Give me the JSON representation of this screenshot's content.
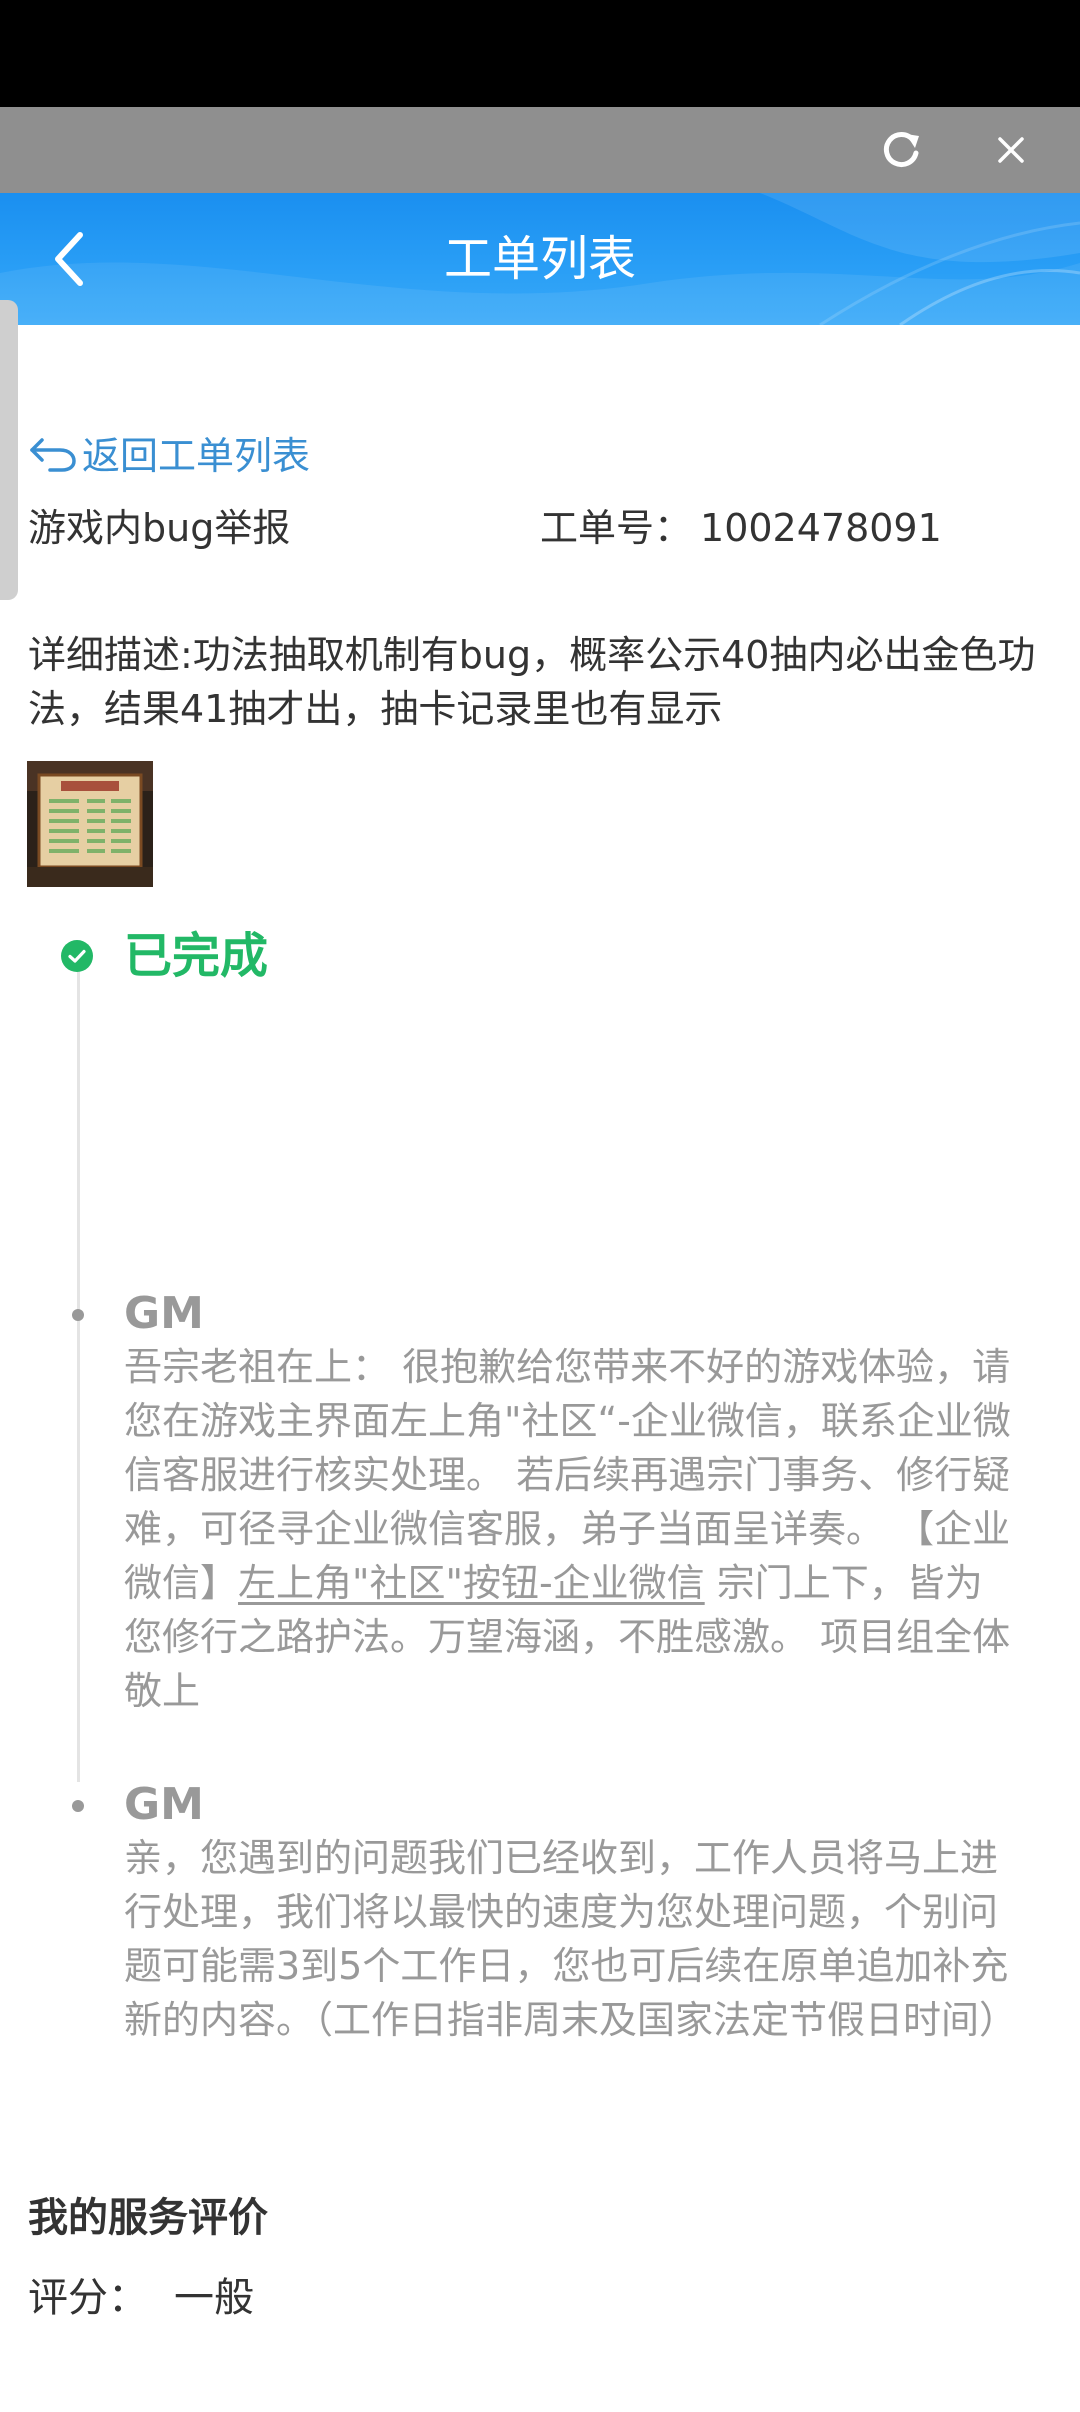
{
  "browser": {
    "refresh_icon": "refresh-icon",
    "close_icon": "close-icon"
  },
  "header": {
    "title": "工单列表",
    "back_icon": "chevron-left-icon",
    "background": "#2a9ff6"
  },
  "ticket": {
    "return_link": "返回工单列表",
    "type": "游戏内bug举报",
    "number_label": "工单号：",
    "number": "1002478091",
    "description": "详细描述:功法抽取机制有bug，概率公示40抽内必出金色功法，结果41抽才出，抽卡记录里也有显示"
  },
  "status": {
    "label": "已完成",
    "color": "#22b866"
  },
  "messages": [
    {
      "author": "GM",
      "body_before": "吾宗老祖在上： 很抱歉给您带来不好的游戏体验，请您在游戏主界面左上角\"社区“-企业微信，联系企业微信客服进行核实处理。 若后续再遇宗门事务、修行疑难，可径寻企业微信客服，弟子当面呈详奏。 【企业微信】",
      "body_link": "左上角\"社区\"按钮-企业微信",
      "body_after": " 宗门上下，皆为您修行之路护法。万望海涵，不胜感激。 项目组全体 敬上"
    },
    {
      "author": "GM",
      "body": "亲，您遇到的问题我们已经收到，工作人员将马上进行处理，我们将以最快的速度为您处理问题，个别问题可能需3到5个工作日，您也可后续在原单追加补充新的内容。（工作日指非周末及国家法定节假日时间）"
    }
  ],
  "evaluation": {
    "title": "我的服务评价",
    "score_label": "评分：",
    "score_value": "一般"
  }
}
